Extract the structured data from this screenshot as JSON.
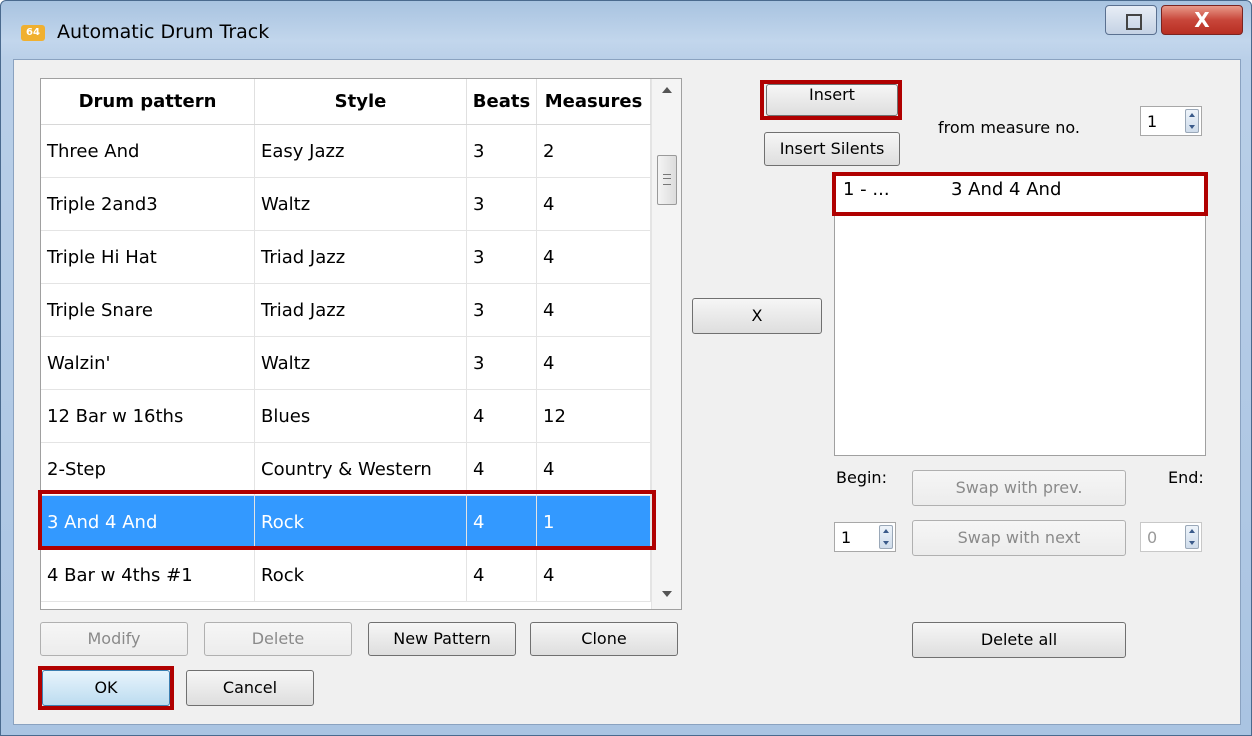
{
  "window": {
    "title": "Automatic Drum Track",
    "app_icon_text": "64",
    "close_label": "X"
  },
  "table": {
    "headers": [
      "Drum pattern",
      "Style",
      "Beats",
      "Measures"
    ],
    "rows": [
      {
        "pattern": "Three And",
        "style": "Easy Jazz",
        "beats": "3",
        "measures": "2"
      },
      {
        "pattern": "Triple 2and3",
        "style": "Waltz",
        "beats": "3",
        "measures": "4"
      },
      {
        "pattern": "Triple Hi Hat",
        "style": "Triad Jazz",
        "beats": "3",
        "measures": "4"
      },
      {
        "pattern": "Triple Snare",
        "style": "Triad Jazz",
        "beats": "3",
        "measures": "4"
      },
      {
        "pattern": "Walzin'",
        "style": "Waltz",
        "beats": "3",
        "measures": "4"
      },
      {
        "pattern": "12 Bar w 16ths",
        "style": "Blues",
        "beats": "4",
        "measures": "12"
      },
      {
        "pattern": "2-Step",
        "style": "Country & Western",
        "beats": "4",
        "measures": "4"
      },
      {
        "pattern": "3 And 4 And",
        "style": "Rock",
        "beats": "4",
        "measures": "1"
      },
      {
        "pattern": "4 Bar w 4ths #1",
        "style": "Rock",
        "beats": "4",
        "measures": "4"
      }
    ]
  },
  "buttons": {
    "modify": "Modify",
    "delete": "Delete",
    "new_pattern": "New Pattern",
    "clone": "Clone",
    "ok": "OK",
    "cancel": "Cancel",
    "insert": "Insert",
    "insert_silents": "Insert Silents",
    "remove": "X",
    "swap_prev": "Swap with prev.",
    "swap_next": "Swap with next",
    "delete_all": "Delete all"
  },
  "labels": {
    "from_measure": "from measure no.",
    "begin": "Begin:",
    "end": "End:"
  },
  "inputs": {
    "from_measure_value": "1",
    "begin_value": "1",
    "end_value": "0"
  },
  "track_list": {
    "items": [
      {
        "number": "1 - ...",
        "name": "3 And 4 And"
      }
    ]
  },
  "colors": {
    "selection": "#3399ff",
    "highlight_box": "#b00000"
  }
}
